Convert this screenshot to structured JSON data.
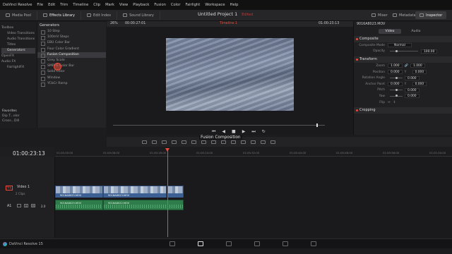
{
  "menubar": {
    "items": [
      "DaVinci Resolve",
      "File",
      "Edit",
      "Trim",
      "Timeline",
      "Clip",
      "Mark",
      "View",
      "Playback",
      "Fusion",
      "Color",
      "Fairlight",
      "Workspace",
      "Help"
    ]
  },
  "toolbar": {
    "left": [
      "Media Pool",
      "Effects Library",
      "Edit Index",
      "Sound Library"
    ],
    "project_title": "Untitled Project 1",
    "edited_label": "Edited",
    "right": [
      "Mixer",
      "Metadata",
      "Inspector"
    ]
  },
  "viewer": {
    "zoom": "26%",
    "source_tc": "00:00:27:01",
    "timeline_name": "Timeline 1",
    "record_tc": "01:00:23:13"
  },
  "effects_tree": [
    "Toolbox",
    "Video Transitions",
    "Audio Transitions",
    "Titles",
    "Generators",
    "OpenFX",
    "Audio FX",
    "FairlightFX"
  ],
  "generators": {
    "header": "Generators",
    "items": [
      "10 Step",
      "100mV Steps",
      "EBU Color Bar",
      "Four Color Gradient",
      "Fusion Composition",
      "Grey Scale",
      "SMPTE Color Bar",
      "Solid Color",
      "Window",
      "YCbCr Ramp"
    ],
    "selected": 4
  },
  "favorites": {
    "header": "Favorites",
    "items": [
      "Dip T...olor",
      "Cross...Dill"
    ]
  },
  "inspector": {
    "clip_name": "9016A8023.MOV",
    "tabs": [
      "Video",
      "Audio"
    ],
    "composite": {
      "title": "Composite",
      "mode_label": "Composite Mode",
      "mode_value": "Normal",
      "opacity_label": "Opacity",
      "opacity_value": "100.00"
    },
    "transform": {
      "title": "Transform",
      "rows": [
        {
          "label": "Zoom",
          "x": "1.000",
          "y": "1.000"
        },
        {
          "label": "Position",
          "x": "0.000",
          "y": "0.000"
        },
        {
          "label": "Rotation Angle",
          "x": "0.000",
          "y": ""
        },
        {
          "label": "Anchor Point",
          "x": "0.000",
          "y": "0.000"
        },
        {
          "label": "Pitch",
          "x": "0.000",
          "y": ""
        },
        {
          "label": "Yaw",
          "x": "0.000",
          "y": ""
        }
      ],
      "flip_label": "Flip"
    },
    "cropping": {
      "title": "Cropping"
    }
  },
  "timeline": {
    "timecode": "01:00:23:13",
    "ruler": [
      "01:00:00:00",
      "01:00:08:00",
      "01:00:16:00",
      "01:00:24:00",
      "01:00:32:00",
      "01:00:40:00",
      "01:00:48:00",
      "01:00:56:00",
      "01:01:04:00",
      "01:01:12:00"
    ],
    "video_track": {
      "id": "V1",
      "name": "Video 1",
      "clip_count": "2 Clips"
    },
    "audio_track": {
      "id": "A1",
      "level": "2.0"
    },
    "clips": [
      "9016A8025.MOV",
      "9016A8023.MOV",
      "9016A8022.MOV"
    ],
    "fusion_label": "Fusion Composition"
  },
  "bottombar": {
    "app_name": "DaVinci Resolve 15"
  }
}
